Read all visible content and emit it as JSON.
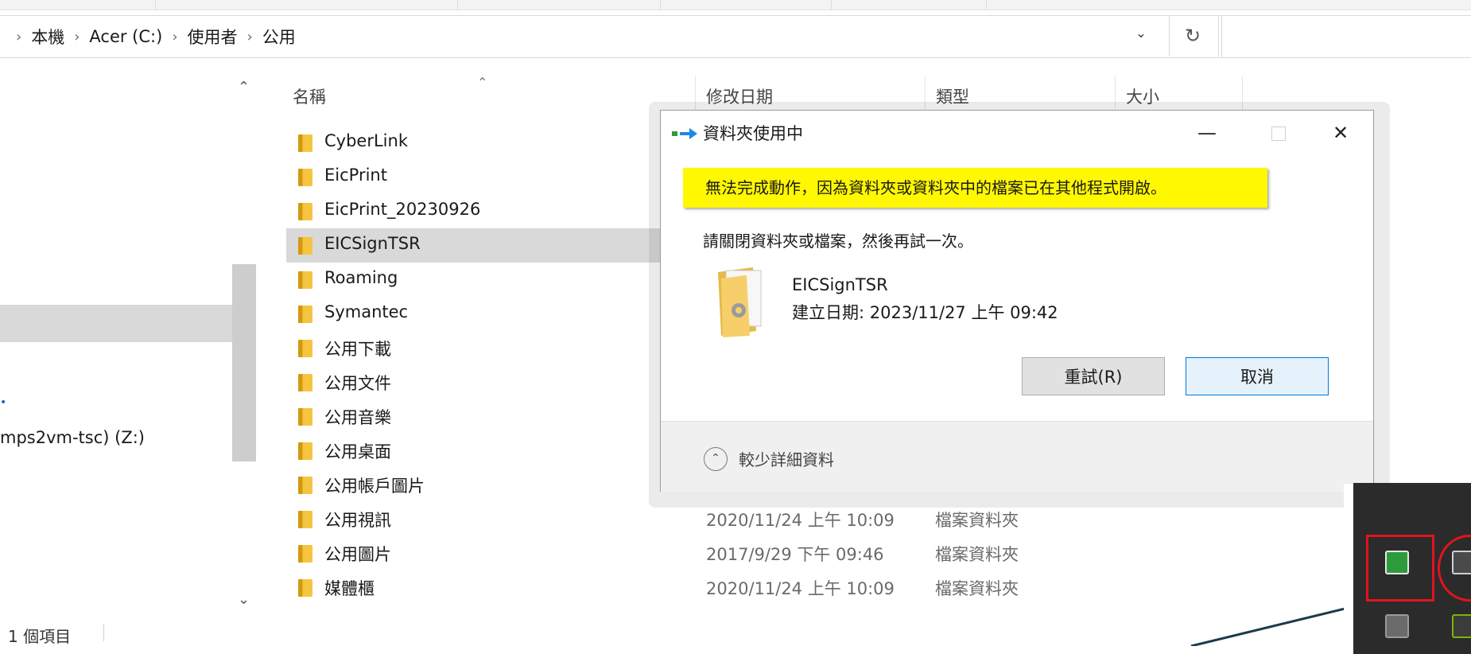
{
  "breadcrumb": [
    "本機",
    "Acer (C:)",
    "使用者",
    "公用"
  ],
  "columns": {
    "name": "名稱",
    "date": "修改日期",
    "type": "類型",
    "size": "大小"
  },
  "nav": {
    "drive_label": "mps2vm-tsc) (Z:)"
  },
  "files": [
    {
      "name": "CyberLink",
      "date": "",
      "type": ""
    },
    {
      "name": "EicPrint",
      "date": "",
      "type": ""
    },
    {
      "name": "EicPrint_20230926",
      "date": "",
      "type": ""
    },
    {
      "name": "EICSignTSR",
      "date": "",
      "type": "",
      "selected": true
    },
    {
      "name": "Roaming",
      "date": "",
      "type": ""
    },
    {
      "name": "Symantec",
      "date": "",
      "type": ""
    },
    {
      "name": "公用下載",
      "date": "",
      "type": ""
    },
    {
      "name": "公用文件",
      "date": "",
      "type": ""
    },
    {
      "name": "公用音樂",
      "date": "",
      "type": ""
    },
    {
      "name": "公用桌面",
      "date": "",
      "type": ""
    },
    {
      "name": "公用帳戶圖片",
      "date": "",
      "type": ""
    },
    {
      "name": "公用視訊",
      "date": "2020/11/24 上午 10:09",
      "type": "檔案資料夾"
    },
    {
      "name": "公用圖片",
      "date": "2017/9/29 下午 09:46",
      "type": "檔案資料夾"
    },
    {
      "name": "媒體櫃",
      "date": "2020/11/24 上午 10:09",
      "type": "檔案資料夾"
    }
  ],
  "status": {
    "items": "1 個項目"
  },
  "dialog": {
    "title": "資料夾使用中",
    "banner": "無法完成動作，因為資料夾或資料夾中的檔案已在其他程式開啟。",
    "instruction": "請關閉資料夾或檔案，然後再試一次。",
    "item_name": "EICSignTSR",
    "item_date": "建立日期: 2023/11/27 上午 09:42",
    "retry_label": "重試(R)",
    "cancel_label": "取消",
    "less_details": "較少詳細資料",
    "minimize": "—",
    "close": "✕"
  },
  "colors": {
    "banner": "#fff800",
    "highlight": "#e0141e",
    "selection": "#d9d9d9"
  }
}
